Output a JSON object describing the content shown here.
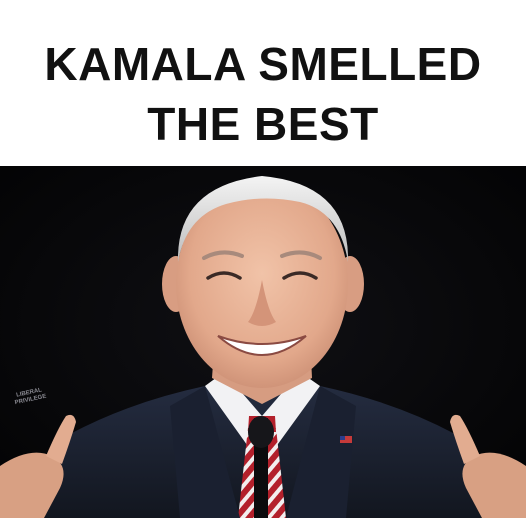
{
  "caption": {
    "line1": "KAMALA SMELLED",
    "line2": "THE BEST"
  },
  "watermark": {
    "line1": "LIBERAL",
    "line2": "PRIVILEGE"
  },
  "colors": {
    "caption_background": "#ffffff",
    "caption_text": "#111111",
    "photo_background": "#040405",
    "suit": "#1c2334",
    "shirt": "#f2f2f4",
    "tie_red": "#b3202b",
    "skin": "#e9b69b"
  }
}
